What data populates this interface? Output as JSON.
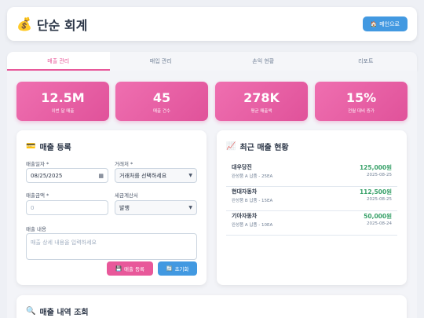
{
  "header": {
    "icon": "money-bag-icon",
    "emoji": "💰",
    "title": "단순 회계",
    "home_icon": "🏠",
    "home_label": "메인으로"
  },
  "tabs": [
    {
      "label": "매출 관리",
      "active": true
    },
    {
      "label": "매입 관리",
      "active": false
    },
    {
      "label": "손익 현황",
      "active": false
    },
    {
      "label": "리포트",
      "active": false
    }
  ],
  "stats": [
    {
      "value": "12.5M",
      "label": "이번 달 매출"
    },
    {
      "value": "45",
      "label": "매출 건수"
    },
    {
      "value": "278K",
      "label": "평균 매출액"
    },
    {
      "value": "15%",
      "label": "전월 대비 증가"
    }
  ],
  "form": {
    "icon": "💳",
    "title": "매출 등록",
    "date_label": "매출일자 *",
    "date_value": "08/25/2025",
    "client_label": "거래처 *",
    "client_value": "거래처를 선택하세요",
    "amount_label": "매출금액 *",
    "amount_placeholder": "0",
    "tax_label": "세금계산서",
    "tax_value": "발행",
    "content_label": "매출 내용",
    "content_placeholder": "매출 상세 내용을 입력하세요",
    "save_icon": "💾",
    "save_label": "매출 등록",
    "reset_icon": "🔄",
    "reset_label": "초기화"
  },
  "recent": {
    "icon": "📈",
    "title": "최근 매출 현황",
    "items": [
      {
        "name": "대우당진",
        "desc": "완성품 A 납품 - 25EA",
        "amount": "125,000원",
        "date": "2025-08-25"
      },
      {
        "name": "현대자동차",
        "desc": "완성품 B 납품 - 15EA",
        "amount": "112,500원",
        "date": "2025-08-25"
      },
      {
        "name": "기아자동차",
        "desc": "완성품 A 납품 - 10EA",
        "amount": "50,000원",
        "date": "2025-08-24"
      }
    ]
  },
  "history": {
    "icon": "🔍",
    "title": "매출 내역 조회"
  },
  "colors": {
    "accent_pink": "#e8589a",
    "accent_blue": "#4299e1",
    "amount_green": "#38a169"
  }
}
